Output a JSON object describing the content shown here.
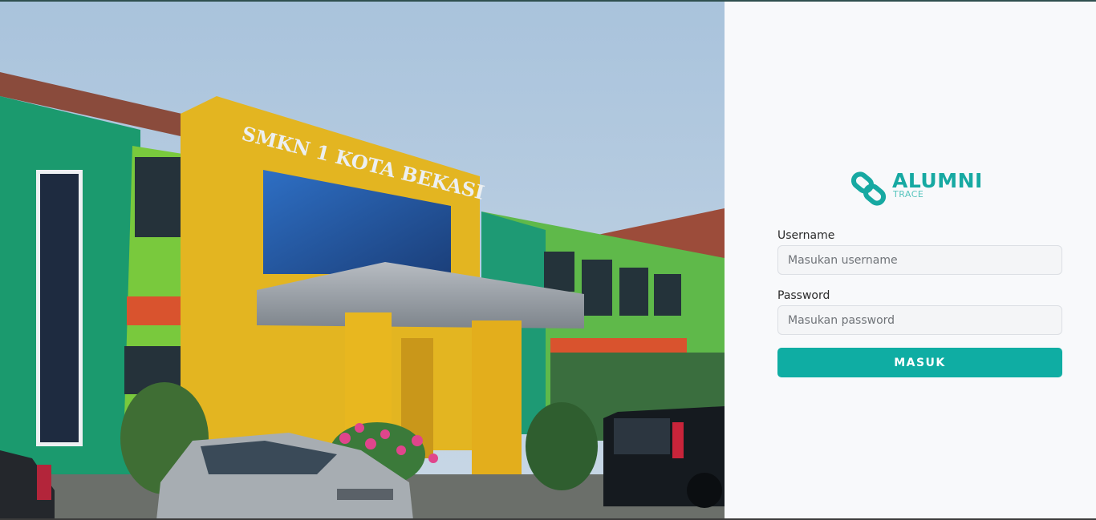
{
  "hero": {
    "building_sign": "SMKN 1 KOTA BEKASI"
  },
  "brand": {
    "name": "ALUMNI",
    "tagline": "TRACE",
    "icon": "chain-link-icon",
    "color": "#17a9a2"
  },
  "login": {
    "username_label": "Username",
    "username_placeholder": "Masukan username",
    "username_value": "",
    "password_label": "Password",
    "password_placeholder": "Masukan password",
    "password_value": "",
    "submit_label": "MASUK",
    "button_color": "#0fada3"
  }
}
